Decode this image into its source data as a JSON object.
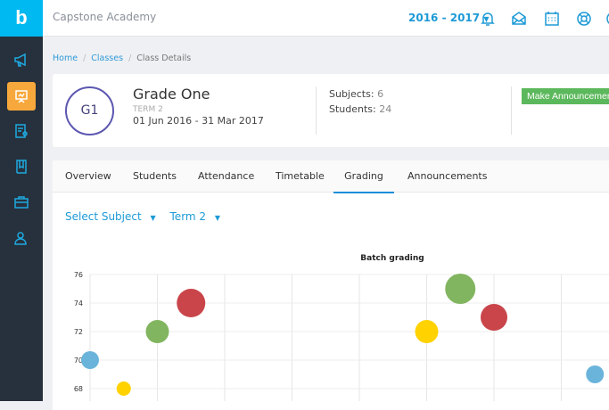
{
  "sidebar": {
    "logo": "b",
    "items": [
      {
        "icon": "megaphone-icon"
      },
      {
        "icon": "presentation-icon",
        "active": true
      },
      {
        "icon": "report-card-icon"
      },
      {
        "icon": "book-icon"
      },
      {
        "icon": "briefcase-icon"
      },
      {
        "icon": "users-icon"
      }
    ]
  },
  "header": {
    "brand": "Capstone Academy",
    "year": "2016 - 2017",
    "icons": [
      "bell-icon",
      "envelope-icon",
      "calendar-icon",
      "lifebuoy-icon"
    ]
  },
  "breadcrumb": {
    "home": "Home",
    "classes": "Classes",
    "current": "Class Details",
    "sep": "/"
  },
  "class": {
    "initials": "G1",
    "name": "Grade One",
    "term": "TERM 2",
    "dates": "01 Jun 2016 - 31 Mar 2017",
    "subjects_label": "Subjects:",
    "subjects": "6",
    "students_label": "Students:",
    "students": "24",
    "announce_button": "Make Announcement"
  },
  "tabs": [
    {
      "label": "Overview"
    },
    {
      "label": "Students"
    },
    {
      "label": "Attendance"
    },
    {
      "label": "Timetable"
    },
    {
      "label": "Grading",
      "active": true
    },
    {
      "label": "Announcements"
    }
  ],
  "filters": {
    "subject": "Select Subject",
    "term": "Term 2"
  },
  "colors": {
    "accent": "#1d9ad6",
    "blue": "#6ab4dc",
    "yellow": "#ffd200",
    "green": "#82b560",
    "red": "#c9454a",
    "success": "#5cb85c",
    "active_nav": "#f7a83c"
  },
  "chart_data": {
    "type": "scatter",
    "title": "Batch grading",
    "ylim": [
      67,
      76
    ],
    "yticks": [
      "76",
      "74",
      "72",
      "70",
      "68"
    ],
    "grid": true,
    "points": [
      {
        "x": 0,
        "y": 70,
        "size": 10,
        "color": "blue"
      },
      {
        "x": 0.5,
        "y": 68,
        "size": 8,
        "color": "yellow"
      },
      {
        "x": 1,
        "y": 72,
        "size": 13,
        "color": "green"
      },
      {
        "x": 1.5,
        "y": 74,
        "size": 16,
        "color": "red"
      },
      {
        "x": 5,
        "y": 72,
        "size": 13,
        "color": "yellow"
      },
      {
        "x": 5.5,
        "y": 75,
        "size": 17,
        "color": "green"
      },
      {
        "x": 6,
        "y": 73,
        "size": 15,
        "color": "red"
      },
      {
        "x": 7.5,
        "y": 69,
        "size": 10,
        "color": "blue"
      }
    ]
  }
}
